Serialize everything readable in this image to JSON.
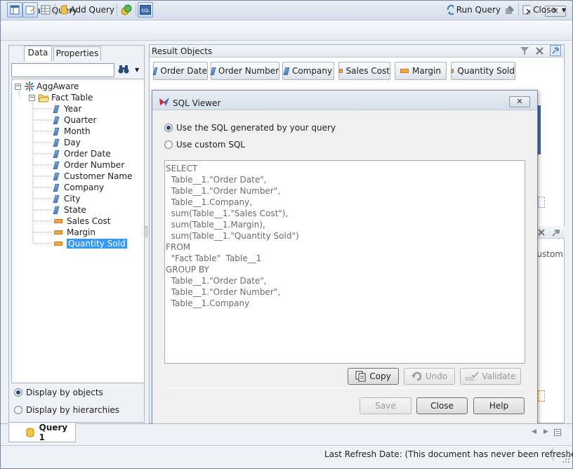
{
  "window": {
    "title": "Create Query",
    "close_glyph": "✕"
  },
  "toolbar": {
    "add_query": "Add Query",
    "run_query": "Run Query",
    "close": "Close"
  },
  "left": {
    "tabs": [
      "Data",
      "Properties"
    ],
    "search_value": "",
    "tree": {
      "root": "AggAware",
      "folder": "Fact Table",
      "dimensions": [
        "Year",
        "Quarter",
        "Month",
        "Day",
        "Order Date",
        "Order Number",
        "Customer Name",
        "Company",
        "City",
        "State"
      ],
      "measures": [
        "Sales Cost",
        "Margin",
        "Quantity Sold"
      ],
      "selected": "Quantity Sold"
    },
    "display_by_objects": "Display by objects",
    "display_by_hierarchies": "Display by hierarchies"
  },
  "result": {
    "header": "Result Objects",
    "objects": [
      {
        "label": "Order Date",
        "kind": "dimension"
      },
      {
        "label": "Order Number",
        "kind": "dimension"
      },
      {
        "label": "Company",
        "kind": "dimension"
      },
      {
        "label": "Sales Cost",
        "kind": "measure"
      },
      {
        "label": "Margin",
        "kind": "measure"
      },
      {
        "label": "Quantity Sold",
        "kind": "measure"
      }
    ],
    "partial_text": "Custom"
  },
  "dialog": {
    "title": "SQL Viewer",
    "option_generated": "Use the SQL generated by your query",
    "option_custom": "Use custom SQL",
    "selected_option": "generated",
    "sql": "SELECT\n  Table__1.\"Order Date\",\n  Table__1.\"Order Number\",\n  Table__1.Company,\n  sum(Table__1.\"Sales Cost\"),\n  sum(Table__1.Margin),\n  sum(Table__1.\"Quantity Sold\")\nFROM\n  \"Fact Table\"  Table__1\nGROUP BY\n  Table__1.\"Order Date\",\n  Table__1.\"Order Number\",\n  Table__1.Company",
    "copy": "Copy",
    "undo": "Undo",
    "validate": "Validate",
    "save": "Save",
    "close": "Close",
    "help": "Help"
  },
  "bottom": {
    "query_tab": "Query 1"
  },
  "status": {
    "text": "Last Refresh Date: (This document has never been refreshed.)"
  },
  "colors": {
    "accent": "#3399ff",
    "measure": "#f3a646",
    "dimension": "#3f78c2"
  }
}
